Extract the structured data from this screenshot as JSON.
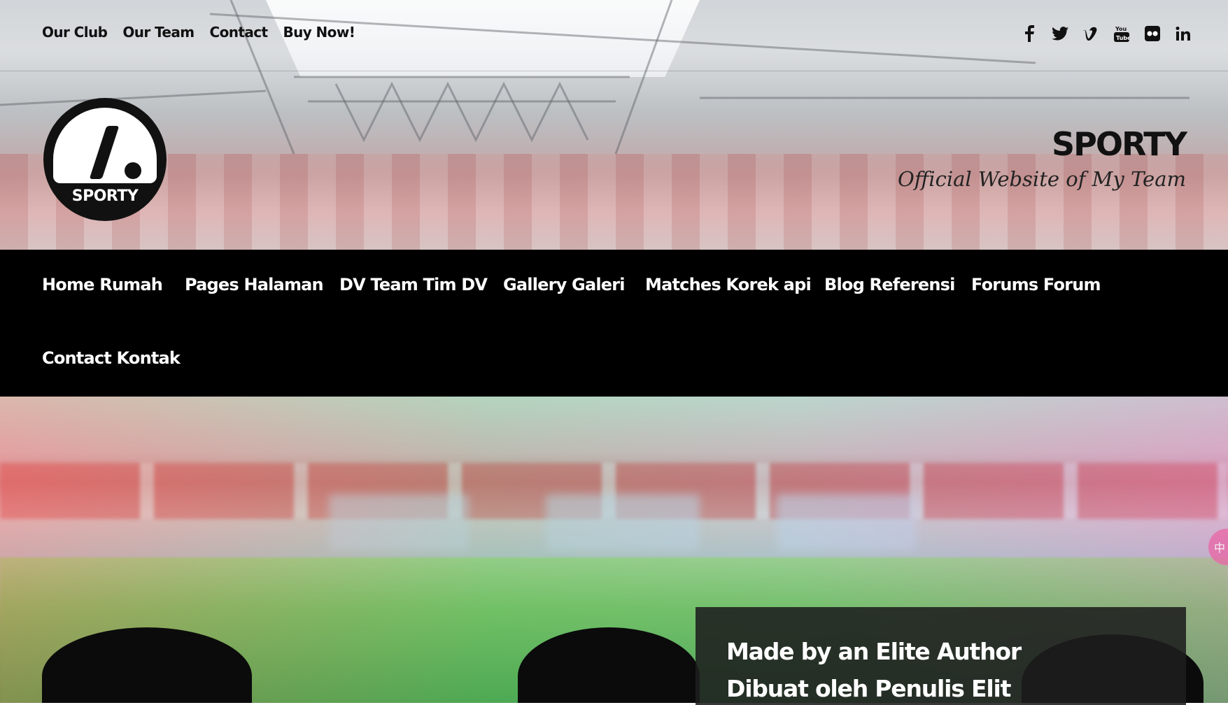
{
  "topbar": {
    "links": [
      "Our Club",
      "Our Team",
      "Contact",
      "Buy Now!"
    ],
    "social_icons": [
      "facebook-icon",
      "twitter-icon",
      "vimeo-icon",
      "youtube-icon",
      "flickr-icon",
      "linkedin-icon"
    ]
  },
  "logo": {
    "text": "SPORTY"
  },
  "brand": {
    "title": "SPORTY",
    "tagline": "Official Website of My Team"
  },
  "nav": {
    "items": [
      "Home Rumah",
      "Pages Halaman",
      "DV Team Tim DV",
      "Gallery Galeri",
      "Matches Korek api",
      "Blog Referensi",
      "Forums Forum",
      "Contact Kontak"
    ]
  },
  "hero": {
    "line1": "Made by an Elite Author",
    "line2": "Dibuat oleh Penulis Elit"
  },
  "side_tab": {
    "label": "中"
  },
  "colors": {
    "nav_bg": "#000000",
    "text_dark": "#111111",
    "hero_box": "#1e1e1e"
  }
}
